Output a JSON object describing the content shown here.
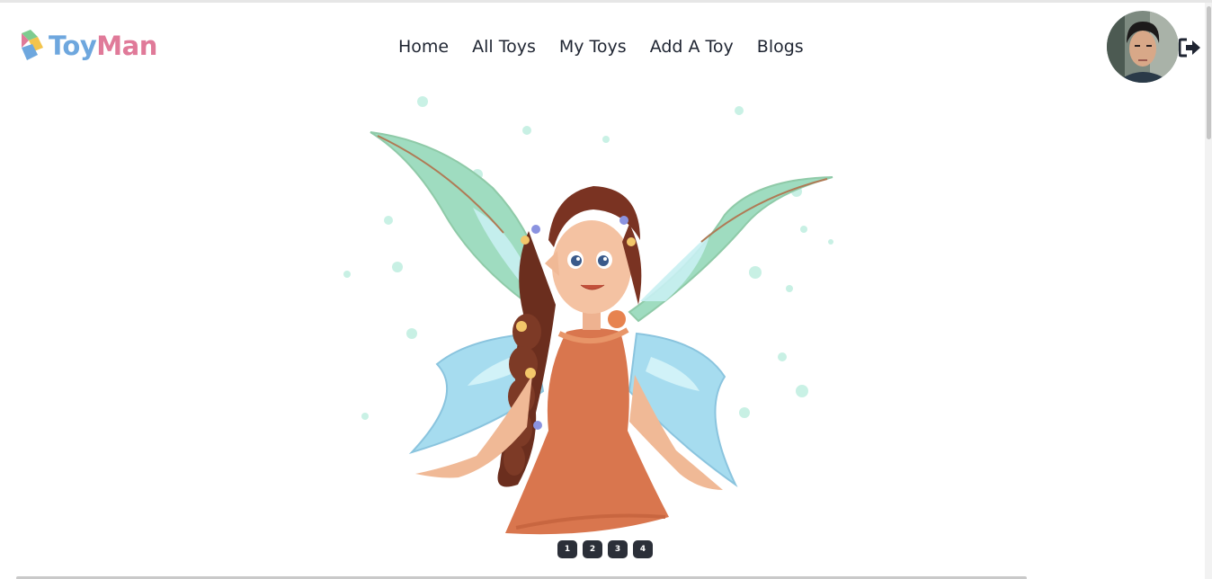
{
  "header": {
    "brand": {
      "part1": "Toy",
      "part2": "Man"
    },
    "nav": [
      {
        "label": "Home"
      },
      {
        "label": "All Toys"
      },
      {
        "label": "My Toys"
      },
      {
        "label": "Add A Toy"
      },
      {
        "label": "Blogs"
      }
    ],
    "avatar_icon": "user-avatar",
    "logout_icon": "logout-icon"
  },
  "carousel": {
    "slide_image": "fairy-illustration",
    "indicators": [
      "1",
      "2",
      "3",
      "4"
    ],
    "active_index": 0
  },
  "colors": {
    "brand_blue": "#6ea7de",
    "brand_pink": "#e07a99",
    "nav_text": "#1f2532",
    "indicator_bg": "#2b2f38"
  }
}
